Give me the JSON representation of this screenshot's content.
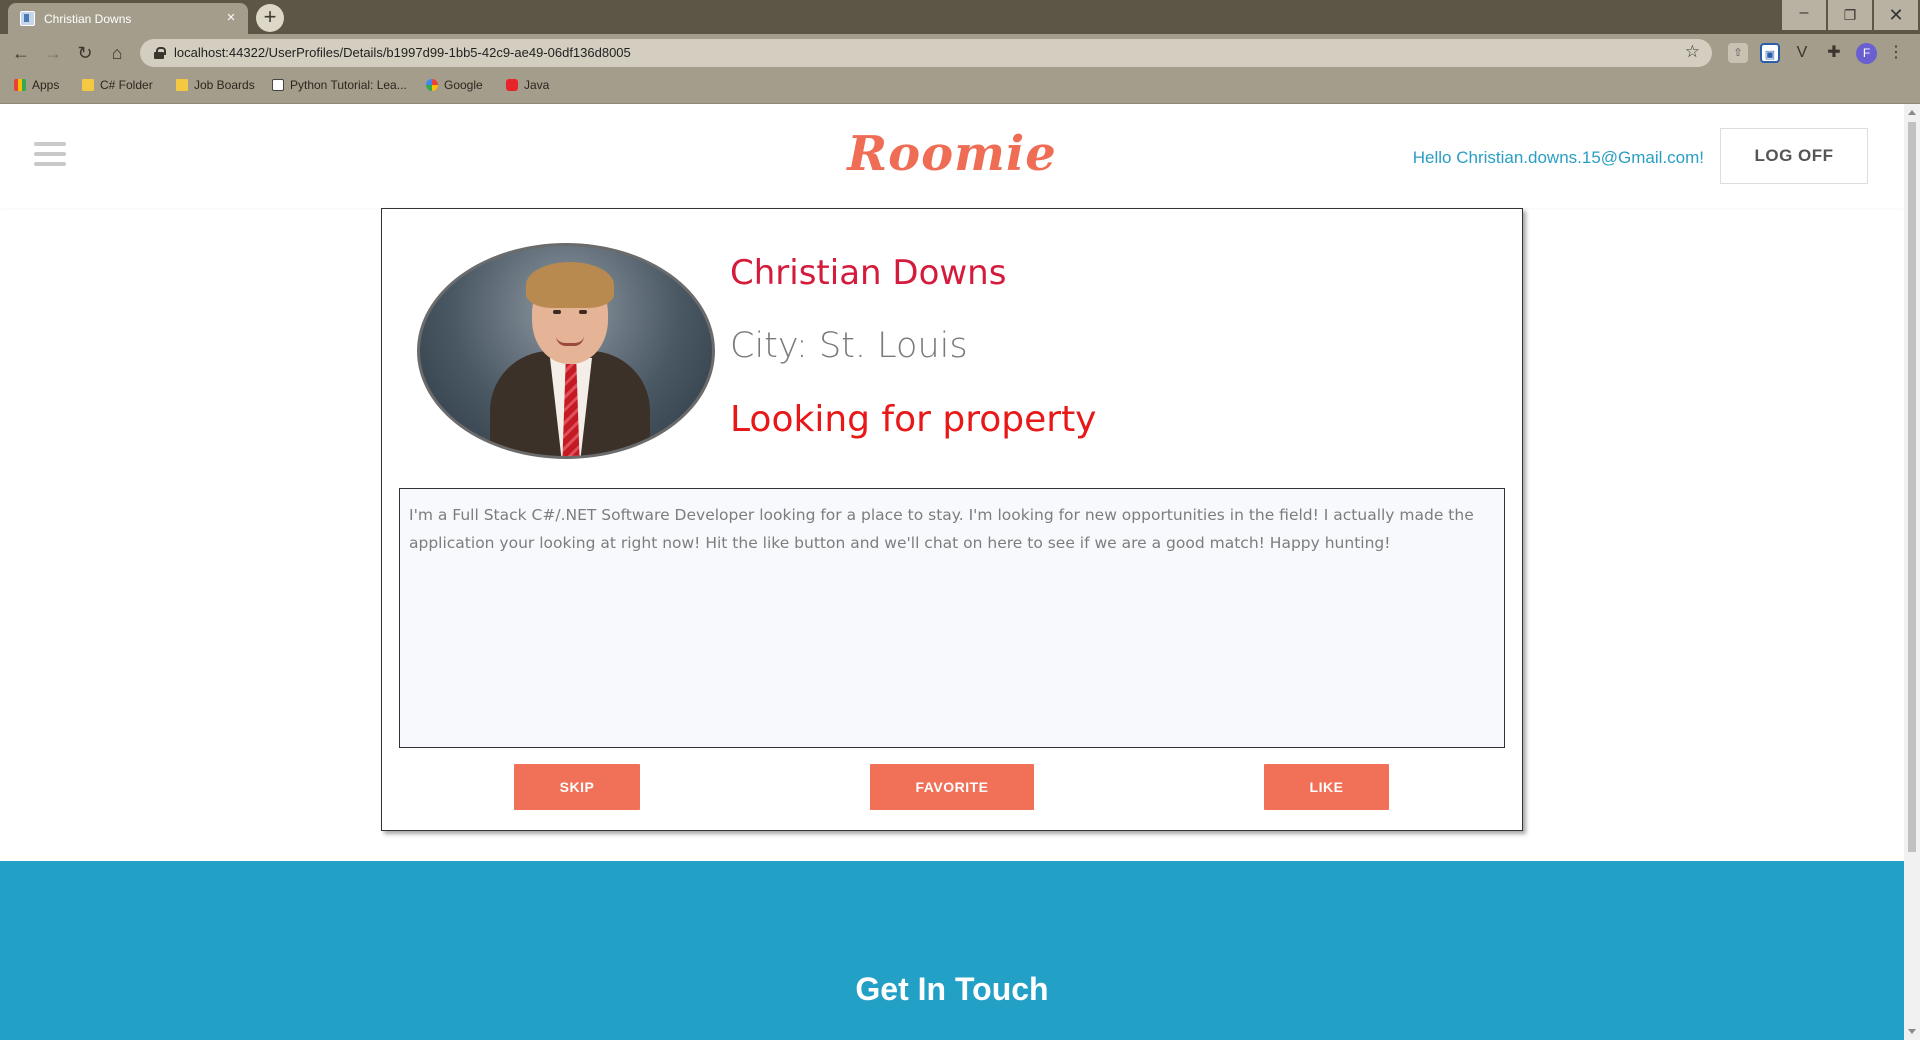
{
  "browser": {
    "tab_title": "Christian Downs",
    "tab_close": "×",
    "new_tab": "+",
    "url": "localhost:44322/UserProfiles/Details/b1997d99-1bb5-42c9-ae49-06df136d8005",
    "profile_initial": "F",
    "window_controls": {
      "minimize": "–",
      "restore": "❐",
      "close": "✕"
    },
    "nav": {
      "back": "←",
      "forward": "→",
      "reload": "↻",
      "home": "⌂"
    },
    "bookmarks": [
      {
        "label": "Apps",
        "icon": "apps-grid-icon"
      },
      {
        "label": "C# Folder",
        "icon": "folder-icon"
      },
      {
        "label": "Job Boards",
        "icon": "folder-icon"
      },
      {
        "label": "Python Tutorial: Lea...",
        "icon": "python-tutorial-icon"
      },
      {
        "label": "Google",
        "icon": "google-icon"
      },
      {
        "label": "Java",
        "icon": "java-icon"
      }
    ]
  },
  "site": {
    "logo": "Roomie",
    "greeting": "Hello Christian.downs.15@Gmail.com!",
    "logoff_label": "LOG OFF"
  },
  "profile": {
    "name": "Christian Downs",
    "city": "City: St. Louis",
    "status": "Looking for property",
    "bio": "I'm a Full Stack C#/.NET Software Developer looking for a place to stay. I'm looking for new opportunities in the field! I actually made the application your looking at right now! Hit the like button and we'll chat on here to see if we are a good match! Happy hunting!",
    "actions": {
      "skip": "SKIP",
      "favorite": "FAVORITE",
      "like": "LIKE"
    }
  },
  "footer": {
    "title": "Get In Touch"
  },
  "colors": {
    "accent": "#f07058",
    "name": "#d41b3b",
    "status": "#e81818",
    "footer": "#23a0c5",
    "greeting": "#2a9ec3"
  }
}
